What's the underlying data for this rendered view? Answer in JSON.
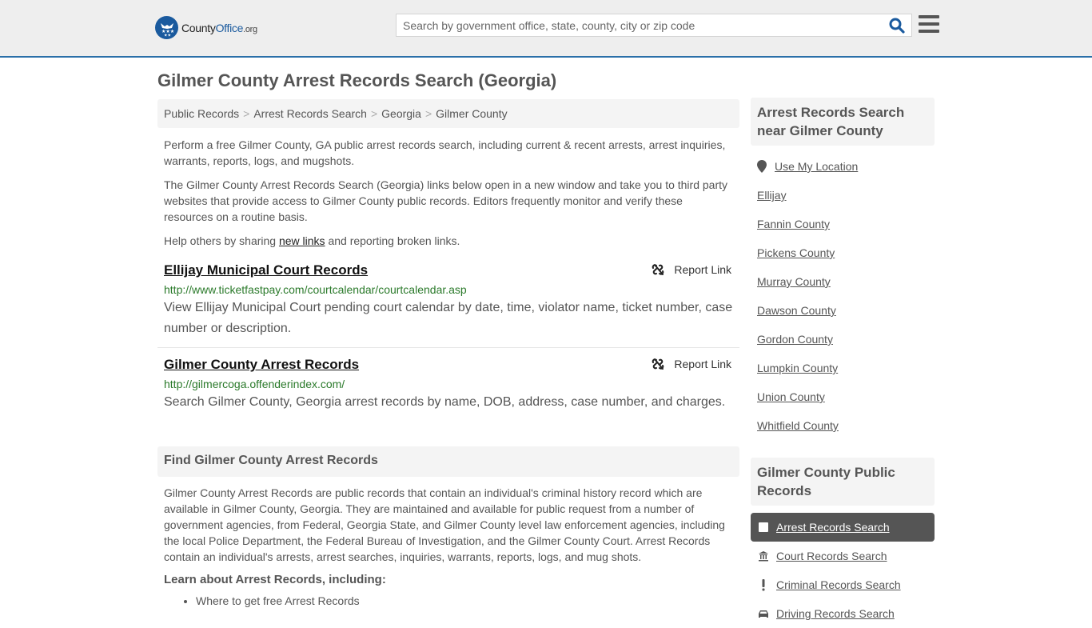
{
  "header": {
    "logo": {
      "county": "County",
      "office": "Office",
      "org": ".org"
    },
    "search_placeholder": "Search by government office, state, county, city or zip code",
    "search_value": ""
  },
  "page_title": "Gilmer County Arrest Records Search (Georgia)",
  "breadcrumb": [
    "Public Records",
    "Arrest Records Search",
    "Georgia",
    "Gilmer County"
  ],
  "intro": {
    "p1": "Perform a free Gilmer County, GA public arrest records search, including current & recent arrests, arrest inquiries, warrants, reports, logs, and mugshots.",
    "p2": "The Gilmer County Arrest Records Search (Georgia) links below open in a new window and take you to third party websites that provide access to Gilmer County public records. Editors frequently monitor and verify these resources on a routine basis.",
    "p3_before": "Help others by sharing ",
    "p3_link": "new links",
    "p3_after": " and reporting broken links."
  },
  "results": [
    {
      "title": "Ellijay Municipal Court Records",
      "url": "http://www.ticketfastpay.com/courtcalendar/courtcalendar.asp",
      "description": "View Ellijay Municipal Court pending court calendar by date, time, violator name, ticket number, case number or description.",
      "report_label": "Report Link"
    },
    {
      "title": "Gilmer County Arrest Records",
      "url": "http://gilmercoga.offenderindex.com/",
      "description": "Search Gilmer County, Georgia arrest records by name, DOB, address, case number, and charges.",
      "report_label": "Report Link"
    }
  ],
  "find_section": {
    "heading": "Find Gilmer County Arrest Records",
    "body": "Gilmer County Arrest Records are public records that contain an individual's criminal history record which are available in Gilmer County, Georgia. They are maintained and available for public request from a number of government agencies, from Federal, Georgia State, and Gilmer County level law enforcement agencies, including the local Police Department, the Federal Bureau of Investigation, and the Gilmer County Court. Arrest Records contain an individual's arrests, arrest searches, inquiries, warrants, reports, logs, and mug shots.",
    "learn_heading": "Learn about Arrest Records, including:",
    "learn_items": [
      "Where to get free Arrest Records"
    ]
  },
  "sidebar_nearby": {
    "heading": "Arrest Records Search near Gilmer County",
    "use_location": "Use My Location",
    "links": [
      "Ellijay",
      "Fannin County",
      "Pickens County",
      "Murray County",
      "Dawson County",
      "Gordon County",
      "Lumpkin County",
      "Union County",
      "Whitfield County"
    ]
  },
  "sidebar_public_records": {
    "heading": "Gilmer County Public Records",
    "items": [
      {
        "label": "Arrest Records Search",
        "icon": "square-icon",
        "active": true
      },
      {
        "label": "Court Records Search",
        "icon": "courthouse-icon",
        "active": false
      },
      {
        "label": "Criminal Records Search",
        "icon": "exclamation-icon",
        "active": false
      },
      {
        "label": "Driving Records Search",
        "icon": "car-icon",
        "active": false
      }
    ]
  },
  "colors": {
    "brand_blue": "#1a5a9e",
    "accent_border": "#2a6fa8",
    "url_green": "#2b7a2b",
    "active_bg": "#555555"
  }
}
